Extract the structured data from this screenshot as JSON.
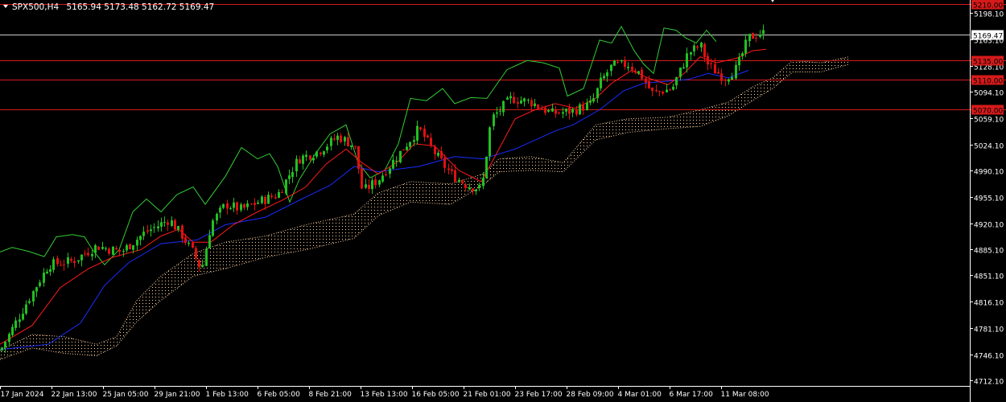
{
  "header": {
    "symbol_label": "SPX500,H4",
    "ohlc_text": "5165.94 5173.48 5162.72 5169.47"
  },
  "colors": {
    "background": "#000000",
    "bull": "#22c022",
    "bear": "#e01010",
    "tenkan": "#ff1a1a",
    "kijun": "#1a2cff",
    "chikou": "#33cc33",
    "cloud": "#ffd2a0",
    "level_line": "#d61a1a",
    "price_line": "#cccccc",
    "axis_text": "#ffffff"
  },
  "chart_data": {
    "type": "candlestick",
    "symbol": "SPX500",
    "timeframe": "H4",
    "ylim": [
      4705,
      5215
    ],
    "y_ticks": [
      5198.1,
      5163.1,
      5128.1,
      5094.1,
      5059.1,
      5024.1,
      4990.1,
      4955.1,
      4920.1,
      4885.1,
      4851.1,
      4816.1,
      4781.1,
      4746.1,
      4712.1
    ],
    "x_labels": [
      "17 Jan 2024",
      "22 Jan 13:00",
      "25 Jan 05:00",
      "29 Jan 21:00",
      "1 Feb 13:00",
      "6 Feb 05:00",
      "8 Feb 21:00",
      "13 Feb 13:00",
      "16 Feb 05:00",
      "21 Feb 01:00",
      "23 Feb 17:00",
      "28 Feb 09:00",
      "4 Mar 01:00",
      "6 Mar 17:00",
      "11 Mar 08:00"
    ],
    "horizontal_levels": [
      {
        "label": "5210.00",
        "value": 5210
      },
      {
        "label": "5135.00",
        "value": 5135
      },
      {
        "label": "5110.00",
        "value": 5110
      },
      {
        "label": "5070.00",
        "value": 5070
      }
    ],
    "current_price": {
      "label": "5169.47",
      "value": 5169.47
    },
    "price_path": [
      [
        0,
        4752
      ],
      [
        30,
        4810
      ],
      [
        60,
        4865
      ],
      [
        90,
        4870
      ],
      [
        120,
        4890
      ],
      [
        150,
        4882
      ],
      [
        180,
        4908
      ],
      [
        210,
        4925
      ],
      [
        225,
        4905
      ],
      [
        240,
        4880
      ],
      [
        250,
        4858
      ],
      [
        262,
        4920
      ],
      [
        280,
        4945
      ],
      [
        300,
        4938
      ],
      [
        320,
        4948
      ],
      [
        345,
        4958
      ],
      [
        370,
        5005
      ],
      [
        395,
        5015
      ],
      [
        420,
        5035
      ],
      [
        440,
        5022
      ],
      [
        450,
        4962
      ],
      [
        470,
        4978
      ],
      [
        500,
        5018
      ],
      [
        520,
        5045
      ],
      [
        540,
        5012
      ],
      [
        560,
        4985
      ],
      [
        580,
        4970
      ],
      [
        598,
        4965
      ],
      [
        610,
        5058
      ],
      [
        635,
        5085
      ],
      [
        660,
        5080
      ],
      [
        685,
        5065
      ],
      [
        710,
        5068
      ],
      [
        735,
        5078
      ],
      [
        745,
        5105
      ],
      [
        760,
        5128
      ],
      [
        780,
        5130
      ],
      [
        795,
        5118
      ],
      [
        810,
        5092
      ],
      [
        835,
        5098
      ],
      [
        855,
        5145
      ],
      [
        870,
        5155
      ],
      [
        880,
        5128
      ],
      [
        900,
        5112
      ],
      [
        915,
        5125
      ],
      [
        930,
        5165
      ],
      [
        945,
        5172
      ],
      [
        952,
        5169.47
      ]
    ],
    "tenkan": [
      [
        0,
        4760
      ],
      [
        40,
        4785
      ],
      [
        75,
        4835
      ],
      [
        110,
        4860
      ],
      [
        140,
        4875
      ],
      [
        175,
        4885
      ],
      [
        200,
        4903
      ],
      [
        222,
        4912
      ],
      [
        240,
        4895
      ],
      [
        262,
        4895
      ],
      [
        290,
        4918
      ],
      [
        320,
        4935
      ],
      [
        350,
        4950
      ],
      [
        380,
        4968
      ],
      [
        405,
        4998
      ],
      [
        430,
        5018
      ],
      [
        450,
        5000
      ],
      [
        470,
        4985
      ],
      [
        495,
        5002
      ],
      [
        515,
        5025
      ],
      [
        540,
        5022
      ],
      [
        570,
        4990
      ],
      [
        598,
        4975
      ],
      [
        615,
        5008
      ],
      [
        640,
        5058
      ],
      [
        665,
        5070
      ],
      [
        690,
        5078
      ],
      [
        715,
        5072
      ],
      [
        740,
        5085
      ],
      [
        760,
        5105
      ],
      [
        785,
        5122
      ],
      [
        805,
        5112
      ],
      [
        830,
        5103
      ],
      [
        850,
        5118
      ],
      [
        870,
        5140
      ],
      [
        890,
        5132
      ],
      [
        915,
        5138
      ],
      [
        935,
        5148
      ],
      [
        952,
        5150
      ]
    ],
    "kijun": [
      [
        0,
        4753
      ],
      [
        60,
        4760
      ],
      [
        100,
        4788
      ],
      [
        130,
        4838
      ],
      [
        160,
        4868
      ],
      [
        200,
        4893
      ],
      [
        245,
        4898
      ],
      [
        280,
        4918
      ],
      [
        330,
        4928
      ],
      [
        375,
        4952
      ],
      [
        410,
        4970
      ],
      [
        440,
        4995
      ],
      [
        470,
        4988
      ],
      [
        520,
        4995
      ],
      [
        565,
        5008
      ],
      [
        600,
        5005
      ],
      [
        640,
        5018
      ],
      [
        690,
        5042
      ],
      [
        712,
        5050
      ],
      [
        745,
        5070
      ],
      [
        775,
        5095
      ],
      [
        800,
        5105
      ],
      [
        855,
        5110
      ],
      [
        880,
        5118
      ],
      [
        905,
        5112
      ],
      [
        930,
        5122
      ]
    ],
    "chikou": [
      [
        0,
        4882
      ],
      [
        15,
        4888
      ],
      [
        35,
        4883
      ],
      [
        55,
        4876
      ],
      [
        70,
        4902
      ],
      [
        90,
        4905
      ],
      [
        105,
        4902
      ],
      [
        115,
        4885
      ],
      [
        130,
        4865
      ],
      [
        148,
        4885
      ],
      [
        165,
        4935
      ],
      [
        182,
        4952
      ],
      [
        200,
        4935
      ],
      [
        220,
        4958
      ],
      [
        240,
        4968
      ],
      [
        255,
        4945
      ],
      [
        280,
        4982
      ],
      [
        300,
        5020
      ],
      [
        320,
        5005
      ],
      [
        335,
        5012
      ],
      [
        345,
        4995
      ],
      [
        360,
        4948
      ],
      [
        372,
        4978
      ],
      [
        392,
        5012
      ],
      [
        410,
        5038
      ],
      [
        430,
        5050
      ],
      [
        445,
        5000
      ],
      [
        460,
        4980
      ],
      [
        478,
        4990
      ],
      [
        495,
        5025
      ],
      [
        510,
        5085
      ],
      [
        530,
        5082
      ],
      [
        550,
        5098
      ],
      [
        565,
        5078
      ],
      [
        585,
        5086
      ],
      [
        605,
        5085
      ],
      [
        630,
        5123
      ],
      [
        655,
        5135
      ],
      [
        675,
        5132
      ],
      [
        695,
        5125
      ],
      [
        705,
        5088
      ],
      [
        725,
        5098
      ],
      [
        745,
        5162
      ],
      [
        760,
        5158
      ],
      [
        772,
        5180
      ],
      [
        788,
        5148
      ],
      [
        800,
        5130
      ],
      [
        812,
        5118
      ],
      [
        825,
        5178
      ],
      [
        840,
        5175
      ],
      [
        852,
        5165
      ],
      [
        865,
        5158
      ],
      [
        878,
        5175
      ],
      [
        890,
        5160
      ]
    ],
    "cloud_span_a": [
      [
        0,
        4752
      ],
      [
        40,
        4773
      ],
      [
        80,
        4770
      ],
      [
        120,
        4760
      ],
      [
        145,
        4770
      ],
      [
        170,
        4818
      ],
      [
        200,
        4850
      ],
      [
        240,
        4880
      ],
      [
        280,
        4895
      ],
      [
        330,
        4903
      ],
      [
        380,
        4918
      ],
      [
        440,
        4932
      ],
      [
        470,
        4960
      ],
      [
        510,
        4975
      ],
      [
        560,
        4972
      ],
      [
        600,
        4985
      ],
      [
        620,
        5005
      ],
      [
        660,
        5008
      ],
      [
        700,
        5000
      ],
      [
        740,
        5050
      ],
      [
        780,
        5058
      ],
      [
        830,
        5060
      ],
      [
        870,
        5070
      ],
      [
        905,
        5080
      ],
      [
        935,
        5100
      ],
      [
        960,
        5112
      ],
      [
        985,
        5135
      ],
      [
        1020,
        5132
      ],
      [
        1055,
        5140
      ]
    ],
    "cloud_span_b": [
      [
        0,
        4740
      ],
      [
        40,
        4755
      ],
      [
        80,
        4748
      ],
      [
        120,
        4745
      ],
      [
        145,
        4758
      ],
      [
        170,
        4790
      ],
      [
        200,
        4818
      ],
      [
        240,
        4850
      ],
      [
        280,
        4860
      ],
      [
        330,
        4875
      ],
      [
        380,
        4885
      ],
      [
        440,
        4900
      ],
      [
        470,
        4930
      ],
      [
        510,
        4948
      ],
      [
        560,
        4945
      ],
      [
        600,
        4970
      ],
      [
        620,
        4988
      ],
      [
        660,
        4990
      ],
      [
        700,
        4988
      ],
      [
        740,
        5030
      ],
      [
        780,
        5040
      ],
      [
        830,
        5045
      ],
      [
        870,
        5048
      ],
      [
        905,
        5062
      ],
      [
        935,
        5082
      ],
      [
        960,
        5098
      ],
      [
        985,
        5120
      ],
      [
        1020,
        5120
      ],
      [
        1055,
        5130
      ]
    ],
    "marker": {
      "shape": "down-triangle",
      "value": 5215
    }
  }
}
